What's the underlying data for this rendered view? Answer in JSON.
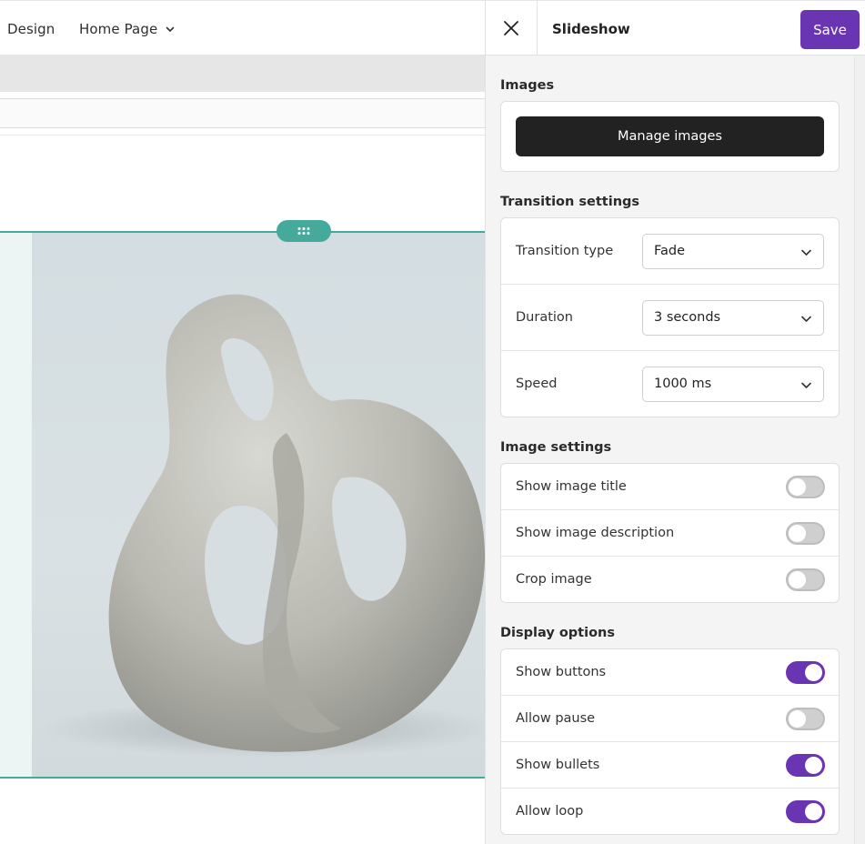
{
  "topnav": {
    "design_label": "Design",
    "home_page_label": "Home Page"
  },
  "panel": {
    "title": "Slideshow",
    "save_label": "Save",
    "images_section": {
      "label": "Images",
      "manage_button": "Manage images"
    },
    "transition_section": {
      "label": "Transition settings",
      "rows": [
        {
          "label": "Transition type",
          "value": "Fade"
        },
        {
          "label": "Duration",
          "value": "3 seconds"
        },
        {
          "label": "Speed",
          "value": "1000 ms"
        }
      ]
    },
    "image_settings_section": {
      "label": "Image settings",
      "toggles": [
        {
          "label": "Show image title",
          "on": false
        },
        {
          "label": "Show image description",
          "on": false
        },
        {
          "label": "Crop image",
          "on": false
        }
      ]
    },
    "display_section": {
      "label": "Display options",
      "toggles": [
        {
          "label": "Show buttons",
          "on": true
        },
        {
          "label": "Allow pause",
          "on": false
        },
        {
          "label": "Show bullets",
          "on": true
        },
        {
          "label": "Allow loop",
          "on": true
        }
      ]
    }
  },
  "colors": {
    "accent": "#6a35b3",
    "frame_teal": "#45a99b",
    "button_dark": "#222222"
  },
  "icons": {
    "close": "close-icon",
    "chevron": "chevron-down-icon",
    "drag": "drag-handle-icon"
  }
}
